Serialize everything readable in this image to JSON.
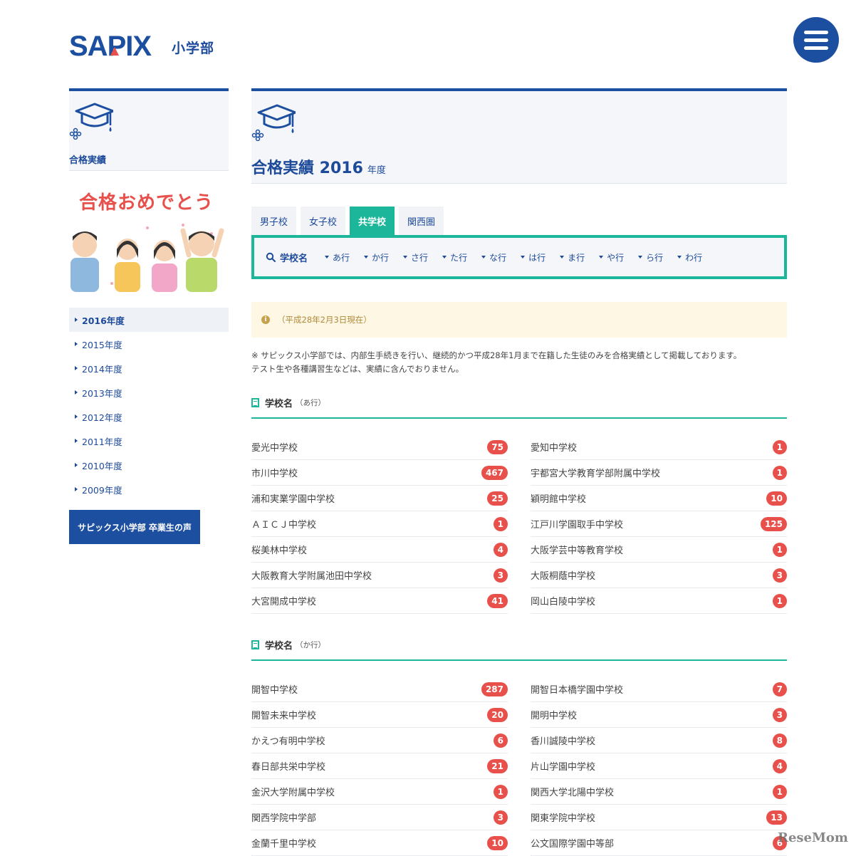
{
  "header": {
    "logo_text": "SAPIX",
    "logo_sub": "小学部"
  },
  "sidebar": {
    "title": "合格実績",
    "banner_text": "合格おめでとう",
    "years": [
      "2016年度",
      "2015年度",
      "2014年度",
      "2013年度",
      "2012年度",
      "2011年度",
      "2010年度",
      "2009年度"
    ],
    "graduate_button": "サピックス小学部 卒業生の声"
  },
  "main": {
    "title": "合格実績 2016",
    "title_suffix": "年度",
    "tabs": [
      "男子校",
      "女子校",
      "共学校",
      "関西圏"
    ],
    "filter_label": "学校名",
    "kana": [
      "あ行",
      "か行",
      "さ行",
      "た行",
      "な行",
      "は行",
      "ま行",
      "や行",
      "ら行",
      "わ行"
    ],
    "notice": "（平成28年2月3日現在）",
    "note_line1": "※ サピックス小学部では、内部生手続きを行い、継続的かつ平成28年1月まで在籍した生徒のみを合格実績として掲載しております。",
    "note_line2": "テスト生や各種講習生などは、実績に含んでおりません。"
  },
  "sections": [
    {
      "title": "学校名",
      "sub": "（あ行）",
      "left": [
        {
          "name": "愛光中学校",
          "count": "75"
        },
        {
          "name": "市川中学校",
          "count": "467"
        },
        {
          "name": "浦和実業学園中学校",
          "count": "25"
        },
        {
          "name": "ＡＩＣＪ中学校",
          "count": "1"
        },
        {
          "name": "桜美林中学校",
          "count": "4"
        },
        {
          "name": "大阪教育大学附属池田中学校",
          "count": "3"
        },
        {
          "name": "大宮開成中学校",
          "count": "41"
        }
      ],
      "right": [
        {
          "name": "愛知中学校",
          "count": "1"
        },
        {
          "name": "宇都宮大学教育学部附属中学校",
          "count": "1"
        },
        {
          "name": "穎明館中学校",
          "count": "10"
        },
        {
          "name": "江戸川学園取手中学校",
          "count": "125"
        },
        {
          "name": "大阪学芸中等教育学校",
          "count": "1"
        },
        {
          "name": "大阪桐蔭中学校",
          "count": "3"
        },
        {
          "name": "岡山白陵中学校",
          "count": "1"
        }
      ]
    },
    {
      "title": "学校名",
      "sub": "（か行）",
      "left": [
        {
          "name": "開智中学校",
          "count": "287"
        },
        {
          "name": "開智未来中学校",
          "count": "20"
        },
        {
          "name": "かえつ有明中学校",
          "count": "6"
        },
        {
          "name": "春日部共栄中学校",
          "count": "21"
        },
        {
          "name": "金沢大学附属中学校",
          "count": "1"
        },
        {
          "name": "関西学院中学部",
          "count": "3"
        },
        {
          "name": "金蘭千里中学校",
          "count": "10"
        }
      ],
      "right": [
        {
          "name": "開智日本橋学園中学校",
          "count": "7"
        },
        {
          "name": "開明中学校",
          "count": "3"
        },
        {
          "name": "香川誠陵中学校",
          "count": "8"
        },
        {
          "name": "片山学園中学校",
          "count": "4"
        },
        {
          "name": "関西大学北陽中学校",
          "count": "1"
        },
        {
          "name": "関東学院中学校",
          "count": "13"
        },
        {
          "name": "公文国際学園中等部",
          "count": "6"
        }
      ]
    }
  ],
  "watermark": "ReseMom",
  "colors": {
    "brand_blue": "#1d4fa0",
    "accent_green": "#1cb79a",
    "badge_red": "#e8504b",
    "notice_bg": "#fdf7e4"
  }
}
